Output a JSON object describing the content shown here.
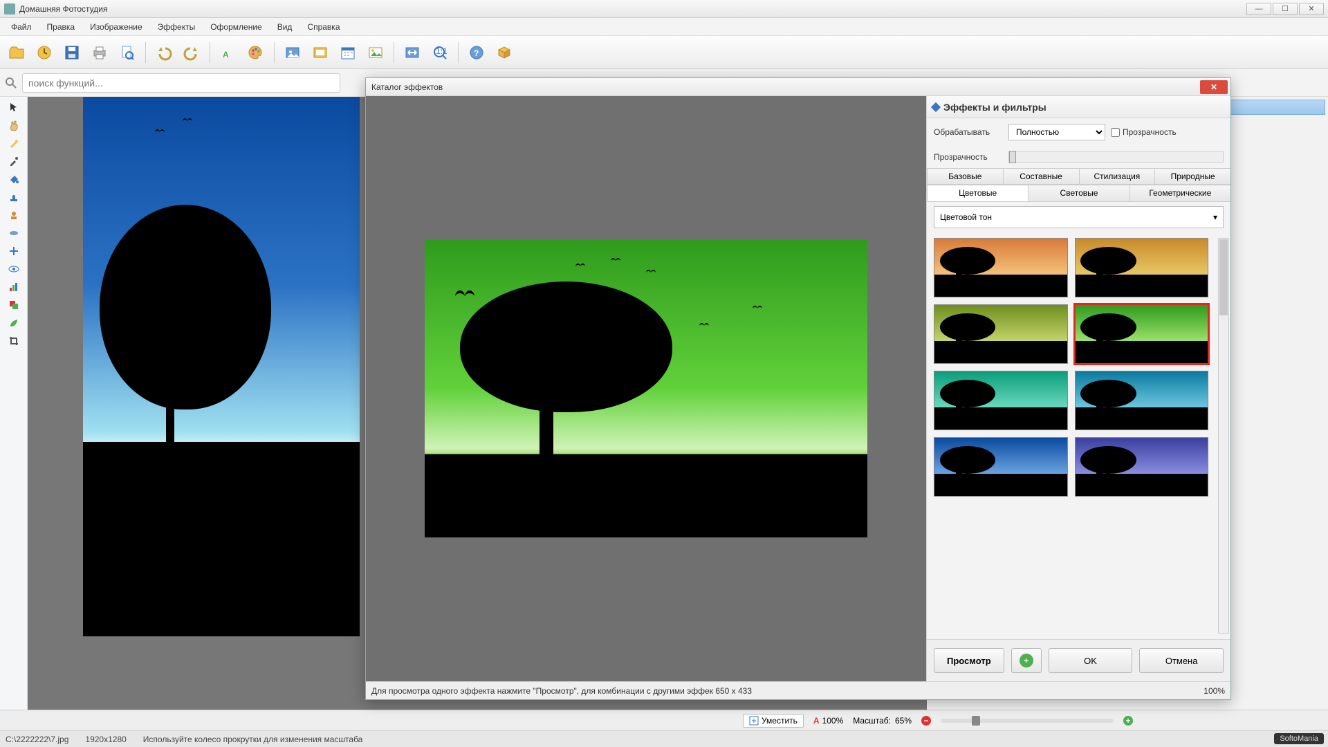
{
  "window": {
    "title": "Домашняя Фотостудия"
  },
  "menu": [
    "Файл",
    "Правка",
    "Изображение",
    "Эффекты",
    "Оформление",
    "Вид",
    "Справка"
  ],
  "search": {
    "placeholder": "поиск функций..."
  },
  "dialog": {
    "title": "Каталог эффектов",
    "section_title": "Эффекты и фильтры",
    "process_label": "Обрабатывать",
    "process_value": "Полностью",
    "transparency_check": "Прозрачность",
    "transparency_label": "Прозрачность",
    "tabs_top": [
      "Базовые",
      "Составные",
      "Стилизация",
      "Природные"
    ],
    "tabs_bottom": [
      "Цветовые",
      "Световые",
      "Геометрические"
    ],
    "active_top": 0,
    "active_bottom": 0,
    "dropdown": "Цветовой тон",
    "buttons": {
      "preview": "Просмотр",
      "ok": "OK",
      "cancel": "Отмена"
    },
    "status_left": "Для просмотра одного эффекта нажмите \"Просмотр\", для комбинации с другими эффек 650 x 433",
    "status_right": "100%",
    "thumb_colors": [
      [
        "#d97b3a",
        "#f3c27a"
      ],
      [
        "#c98a2a",
        "#e8c766"
      ],
      [
        "#6e8e1e",
        "#c4d46a"
      ],
      [
        "#2f9b1d",
        "#9be06a"
      ],
      [
        "#0a9d7a",
        "#69d9bd"
      ],
      [
        "#0a7aa0",
        "#6cc6e0"
      ],
      [
        "#0a4aa0",
        "#6aa3e0"
      ],
      [
        "#3a3fa0",
        "#8a8de0"
      ]
    ],
    "selected_thumb": 3
  },
  "scalebar": {
    "fit": "Уместить",
    "hundred": "100%",
    "scale_label": "Масштаб:",
    "scale_value": "65%"
  },
  "pathbar": {
    "path": "C:\\2222222\\7.jpg",
    "dims": "1920x1280",
    "hint": "Используйте колесо прокрутки для изменения масштаба"
  },
  "branding": "SoftoMania"
}
